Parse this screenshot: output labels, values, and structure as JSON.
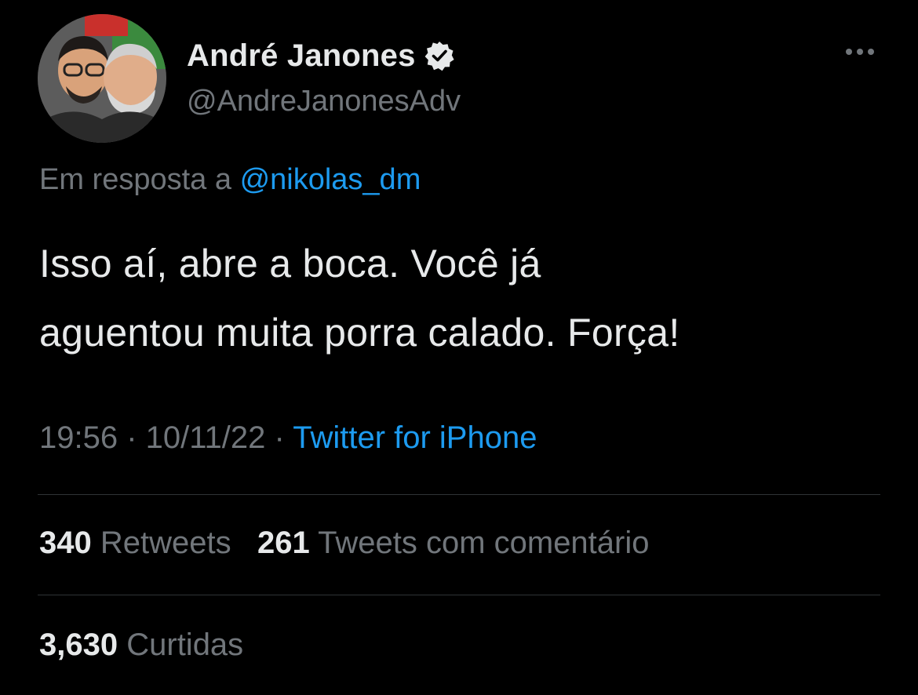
{
  "author": {
    "display_name": "André Janones",
    "handle": "@AndreJanonesAdv",
    "verified_icon": "verified-badge-icon"
  },
  "more_icon": "more-horizontal-icon",
  "reply": {
    "prefix": "Em resposta a ",
    "mention": "@nikolas_dm"
  },
  "tweet": {
    "line1": "Isso aí, abre a boca. Você já",
    "line2": "aguentou muita porra calado. Força!"
  },
  "meta": {
    "time": "19:56",
    "date": "10/11/22",
    "separator": " · ",
    "source": "Twitter for iPhone"
  },
  "stats": {
    "retweets_count": "340",
    "retweets_label": "Retweets",
    "quotes_count": "261",
    "quotes_label": "Tweets com comentário",
    "likes_count": "3,630",
    "likes_label": "Curtidas"
  },
  "colors": {
    "background": "#000000",
    "text_primary": "#e7e9ea",
    "text_secondary": "#71767b",
    "link": "#1d9bf0",
    "divider": "#2f3336"
  }
}
